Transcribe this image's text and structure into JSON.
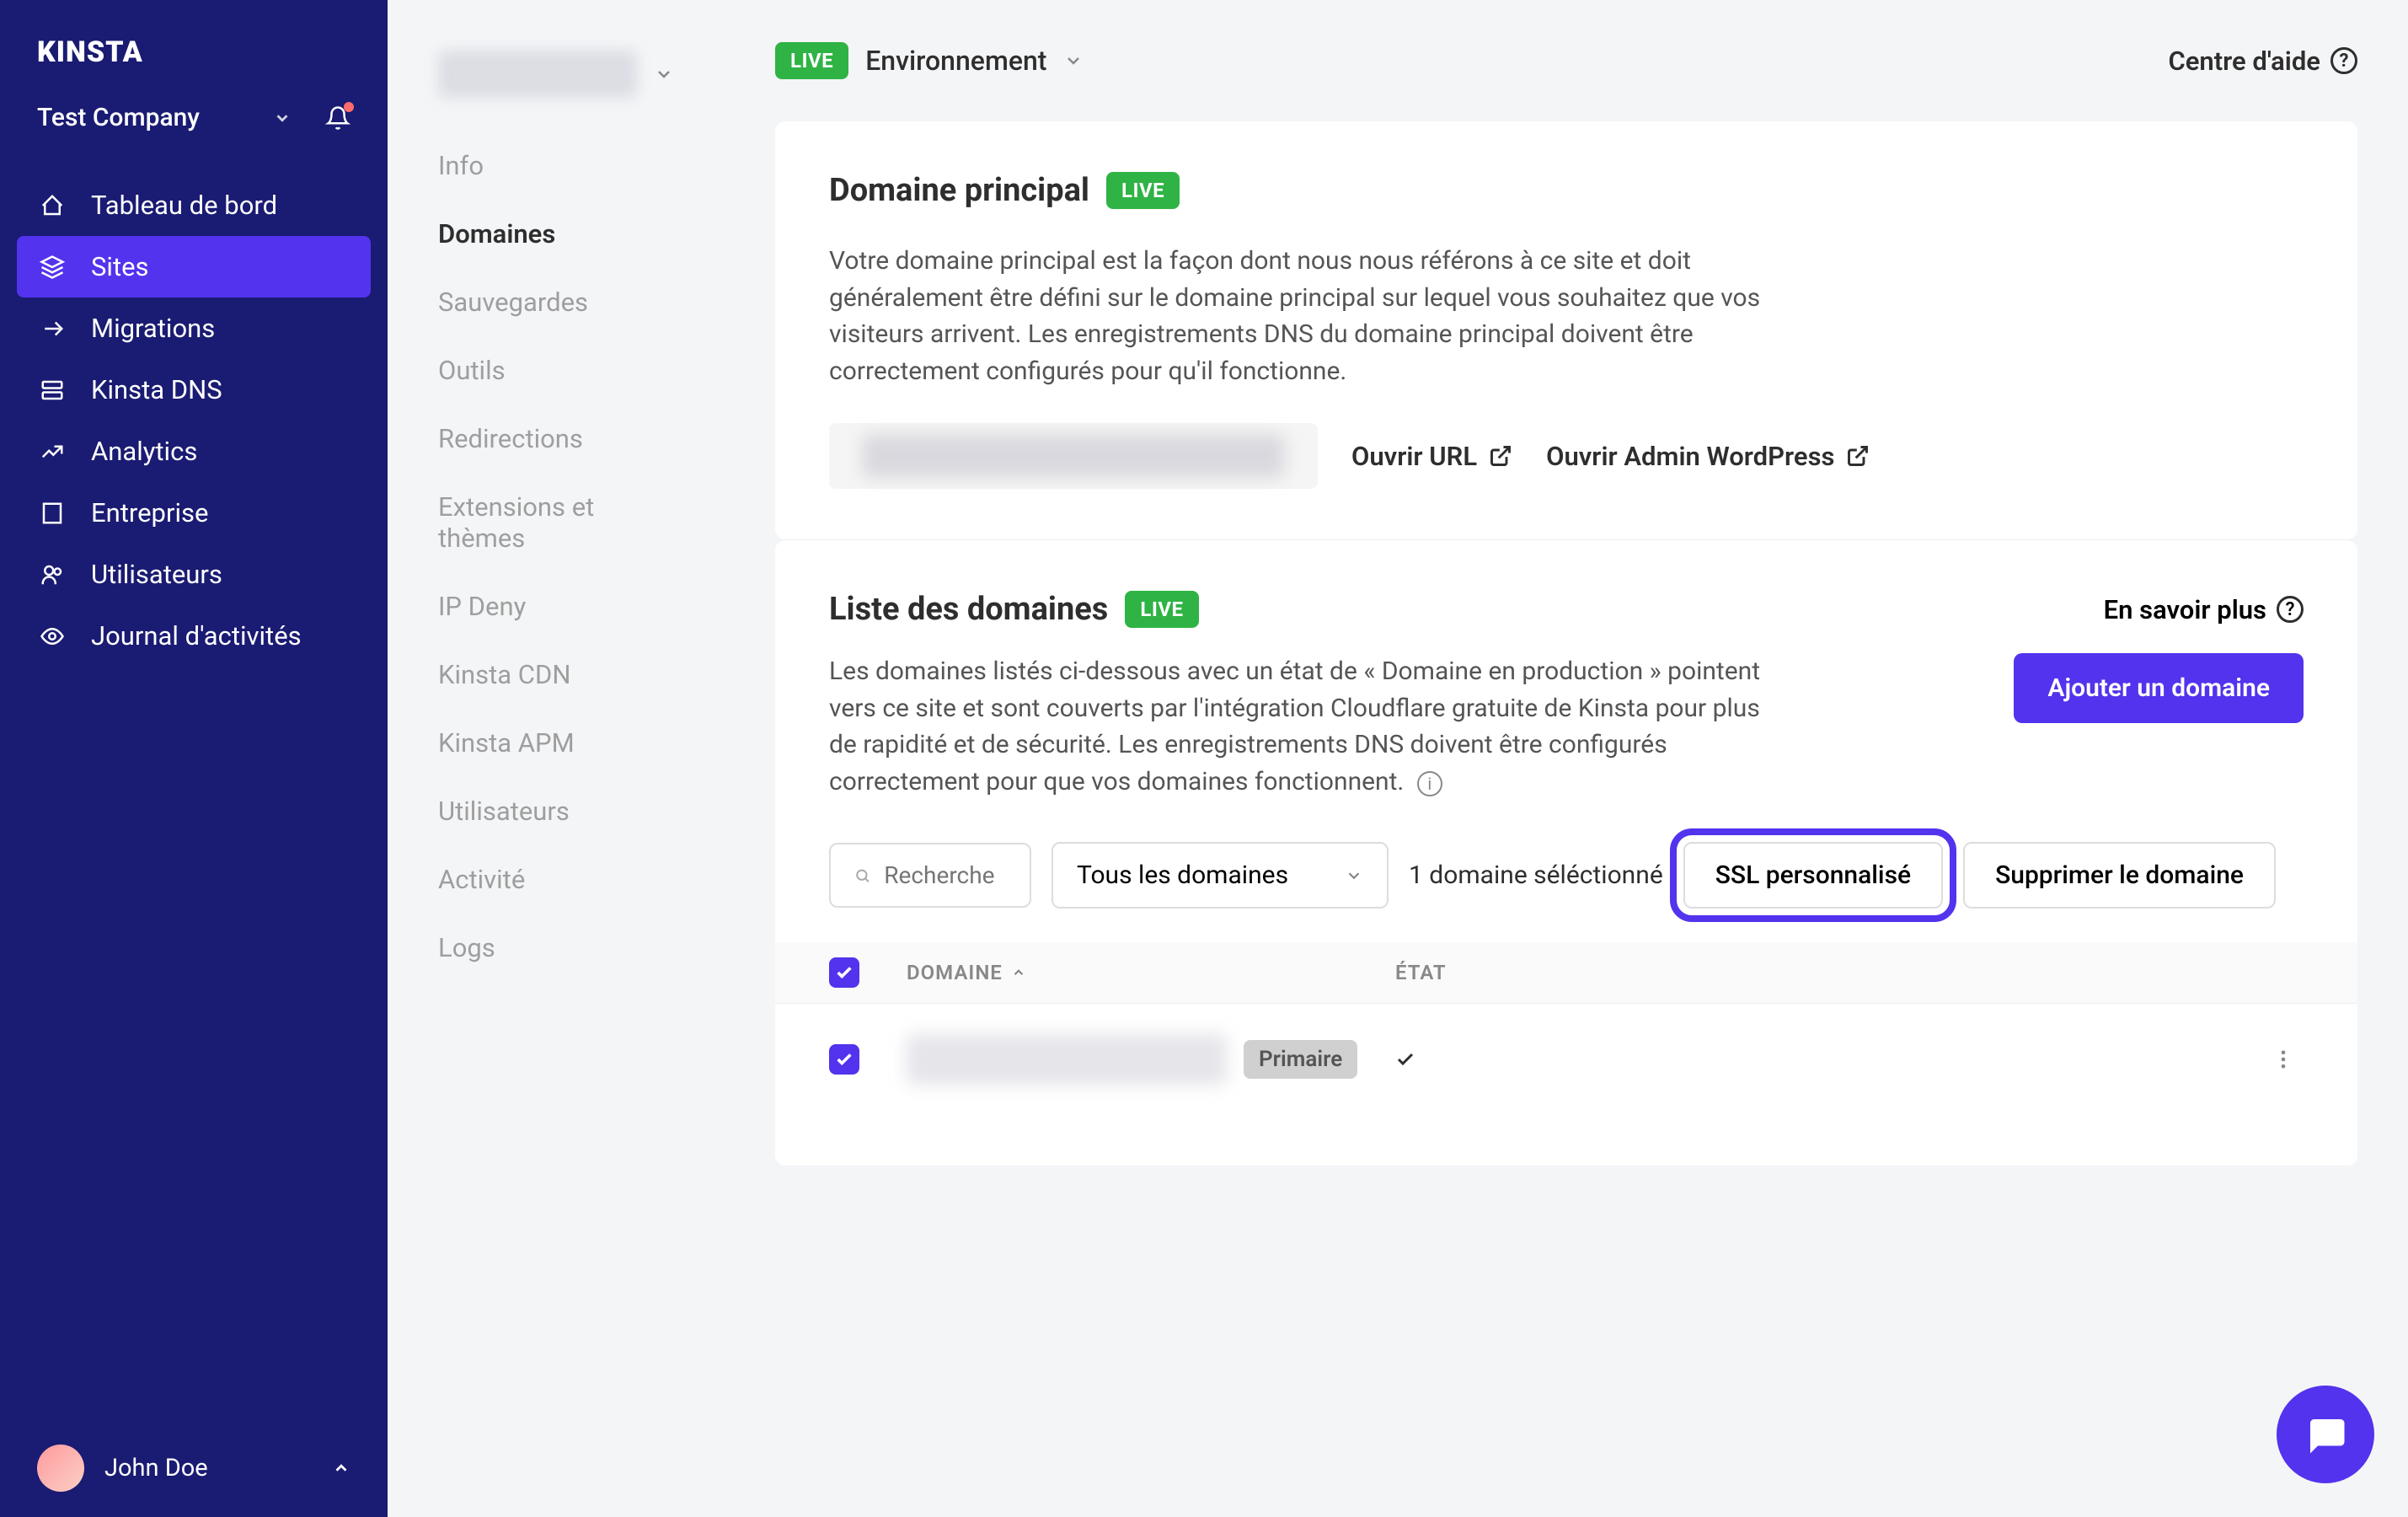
{
  "brand": "Kinsta",
  "company": {
    "name": "Test Company"
  },
  "nav": {
    "dashboard": "Tableau de bord",
    "sites": "Sites",
    "migrations": "Migrations",
    "dns": "Kinsta DNS",
    "analytics": "Analytics",
    "company_item": "Entreprise",
    "users": "Utilisateurs",
    "activity": "Journal d'activités"
  },
  "user": {
    "name": "John Doe"
  },
  "subnav": {
    "info": "Info",
    "domains": "Domaines",
    "backups": "Sauvegardes",
    "tools": "Outils",
    "redirects": "Redirections",
    "plugins": "Extensions et thèmes",
    "ipdeny": "IP Deny",
    "cdn": "Kinsta CDN",
    "apm": "Kinsta APM",
    "users": "Utilisateurs",
    "activity": "Activité",
    "logs": "Logs"
  },
  "topbar": {
    "live": "LIVE",
    "env": "Environnement",
    "help": "Centre d'aide"
  },
  "primary": {
    "title": "Domaine principal",
    "live": "LIVE",
    "desc": "Votre domaine principal est la façon dont nous nous référons à ce site et doit généralement être défini sur le domaine principal sur lequel vous souhaitez que vos visiteurs arrivent. Les enregistrements DNS du domaine principal doivent être correctement configurés pour qu'il fonctionne.",
    "open_url": "Ouvrir URL",
    "open_wp": "Ouvrir Admin WordPress"
  },
  "domains": {
    "title": "Liste des domaines",
    "live": "LIVE",
    "learn_more": "En savoir plus",
    "desc": "Les domaines listés ci-dessous avec un état de « Domaine en production » pointent vers ce site et sont couverts par l'intégration Cloudflare gratuite de Kinsta pour plus de rapidité et de sécurité. Les enregistrements DNS doivent être configurés correctement pour que vos domaines fonctionnent.",
    "add": "Ajouter un domaine",
    "search_placeholder": "Recherche",
    "filter": "Tous les domaines",
    "selection": "1 domaine séléctionné",
    "custom_ssl": "SSL personnalisé",
    "delete": "Supprimer le domaine",
    "th_domain": "DOMAINE",
    "th_state": "ÉTAT",
    "badge_primary": "Primaire"
  }
}
